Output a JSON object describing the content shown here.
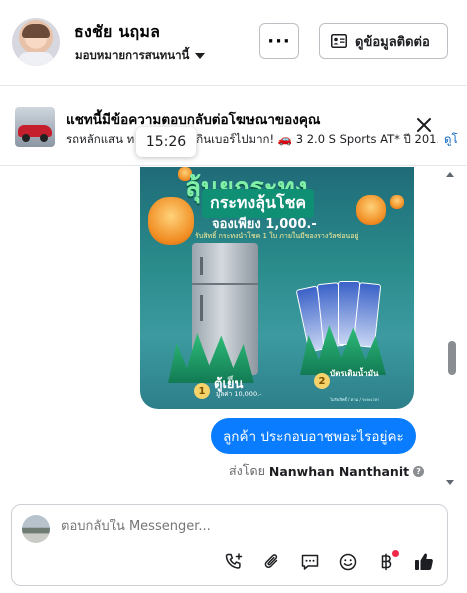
{
  "header": {
    "name": "ธงชัย นฤมล",
    "subtitle": "มอบหมายการสนทนานี้",
    "more_label": "···",
    "contact_label": "ดูข้อมูลติดต่อ"
  },
  "ad_banner": {
    "title": "แชทนี้มีข้อความตอบกลับต่อโฆษณาของคุณ",
    "snippet_prefix": "รถหลักแสน ท",
    "snippet_mid": "กินเบอร์ไปมาก!",
    "snippet_suffix": "3 2.0 S Sports AT* ปี 201...",
    "link_label": "ดูโ",
    "time_tooltip": "15:26"
  },
  "promo_image": {
    "title_line1": "ลุ้นยกระทง",
    "title_line2": "กระทงลุ้นโชค",
    "title_line3": "จองเพียง 1,000.-",
    "note": "รับสิทธิ์ กระทงนำโชค 1 ใบ ภายในมีของรางวัลซ่อนอยู่",
    "prize1": "ตู้เย็น",
    "prize1_value": "มูลค่า 10,000.-",
    "prize2": "บัตรเติมน้ำมัน",
    "card_text": "บัตรเติมน้ำมัน",
    "fineprint": "ไม่รับสิทธิ์ / ตาม / ระยะเวลา"
  },
  "messages": [
    {
      "text": "ลูกค้า ประกอบอาชพอะไรอยู่คะ",
      "from": "me"
    }
  ],
  "sent_by": {
    "prefix": "ส่งโดย",
    "name": "Nanwhan Nanthanit",
    "help": "?"
  },
  "composer": {
    "placeholder": "ตอบกลับใน Messenger..."
  },
  "colors": {
    "accent": "#0a7cff",
    "badge": "#f02849"
  },
  "icons": [
    "call-add-icon",
    "attachment-icon",
    "saved-reply-icon",
    "emoji-icon",
    "payment-baht-icon",
    "like-icon"
  ]
}
